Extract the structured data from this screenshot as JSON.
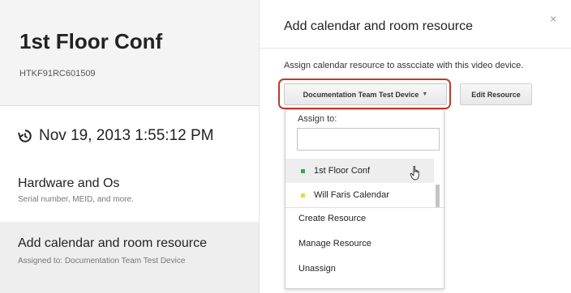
{
  "device": {
    "title": "1st Floor Conf",
    "serial": "HTKF91RC601509"
  },
  "history": {
    "timestamp": "Nov 19, 2013 1:55:12 PM",
    "icon": "history-icon"
  },
  "sections": {
    "hardware": {
      "title": "Hardware and Os",
      "subtitle": "Serial number, MEID, and more."
    },
    "calendar": {
      "title": "Add calendar and room resource",
      "subtitle": "Assigned to: Documentation Team Test Device"
    }
  },
  "panel": {
    "title": "Add calendar and room resource",
    "description": "Assign calendar resource to asscciate with this video device.",
    "device_button": "Documentation Team Test Device",
    "edit_button": "Edit Resource",
    "close": "×"
  },
  "dropdown": {
    "label": "Assign to:",
    "search_value": "",
    "items": [
      {
        "label": "1st Floor Conf",
        "color": "#3aa757"
      },
      {
        "label": "Will Faris Calendar",
        "color": "#f3d24a"
      }
    ],
    "actions": [
      "Create Resource",
      "Manage Resource",
      "Unassign"
    ]
  },
  "colors": {
    "highlight_border": "#c0392b"
  }
}
